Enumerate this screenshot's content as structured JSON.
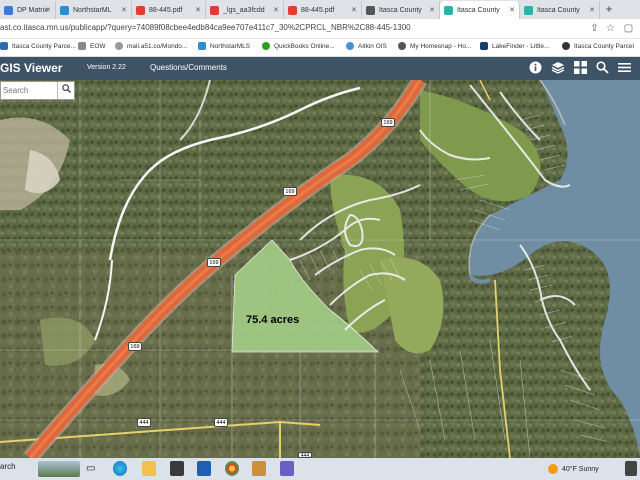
{
  "browser": {
    "tabs": [
      {
        "label": "DP Matrix",
        "icon": "flexmls-icon",
        "color": "#3a7bd5"
      },
      {
        "label": "NorthstarML",
        "icon": "flexmls-icon",
        "color": "#2a8fd0"
      },
      {
        "label": "88-445.pdf",
        "icon": "pdf-icon",
        "color": "#e53935"
      },
      {
        "label": "_lgs_aa3fcdd",
        "icon": "pdf-icon",
        "color": "#e53935"
      },
      {
        "label": "88-445.pdf",
        "icon": "pdf-icon",
        "color": "#e53935"
      },
      {
        "label": "Itasca County",
        "icon": "county-icon",
        "color": "#555555"
      },
      {
        "label": "Itasca County",
        "icon": "county-icon",
        "color": "#2bb3a8"
      },
      {
        "label": "Itasca County",
        "icon": "county-icon",
        "color": "#2bb3a8"
      }
    ],
    "new_tab": "+",
    "url": "ast.co.itasca.mn.us/publicapp/?query=74089f08cbee4edb84ca9ee707e411c7_30%2CPRCL_NBR%2C88-445-1300",
    "bookmarks": [
      {
        "label": "Itasca County Parce...",
        "color": "#2b6cb0"
      },
      {
        "label": "EOW",
        "color": "#888888"
      },
      {
        "label": "mail.a51.co/Mondo...",
        "color": "#999999"
      },
      {
        "label": "NorthstarMLS",
        "color": "#2a8fd0"
      },
      {
        "label": "QuickBooks Online...",
        "color": "#2ca01c"
      },
      {
        "label": "Aitkin GIS",
        "color": "#4a90d9"
      },
      {
        "label": "My Homesnap - Ho...",
        "color": "#555555"
      },
      {
        "label": "LakeFinder - Little...",
        "color": "#1a3b6e"
      },
      {
        "label": "Itasca County Parcel",
        "color": "#333333"
      }
    ]
  },
  "app": {
    "title": "GIS Viewer",
    "version": "Version 2.22",
    "questions": "Questions/Comments",
    "search_placeholder": "Search"
  },
  "map": {
    "parcel_label": "75.4 acres",
    "highway_shield": "169",
    "road_labels": [
      "169",
      "169",
      "169",
      "169",
      "444",
      "444",
      "444"
    ]
  },
  "taskbar": {
    "search_label": "arch",
    "weather": "40°F  Sunny"
  }
}
